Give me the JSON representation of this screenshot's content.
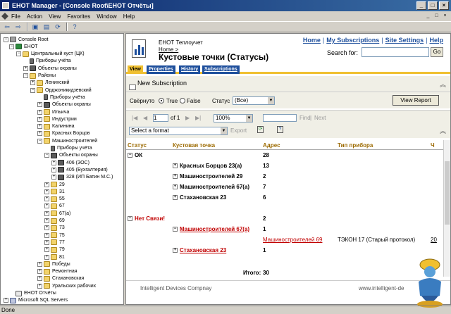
{
  "window": {
    "title": "ЕНОТ Manager - [Console Root\\ЕНОТ Отчёты]",
    "controls": [
      "_",
      "□",
      "×"
    ]
  },
  "menu": {
    "items": [
      "File",
      "Action",
      "View",
      "Favorites",
      "Window",
      "Help"
    ],
    "mdi_controls": [
      "_",
      "□",
      "×"
    ]
  },
  "toolbar": {
    "buttons": [
      "back-icon",
      "forward-icon",
      "up-icon",
      "properties-icon",
      "refresh-icon",
      "help-icon"
    ]
  },
  "tree": {
    "nodes": [
      {
        "label": "Console Root",
        "icon": "root",
        "exp": "-"
      },
      {
        "label": "ЕНОТ",
        "icon": "enot",
        "exp": "-"
      },
      {
        "label": "Центральный куст (ЦК)",
        "icon": "folder",
        "exp": "-"
      },
      {
        "label": "Приборы учёта",
        "icon": "device",
        "exp": ""
      },
      {
        "label": "Объекты охраны",
        "icon": "meter",
        "exp": "+"
      },
      {
        "label": "Районы",
        "icon": "folder",
        "exp": "-"
      },
      {
        "label": "Ленинский",
        "icon": "folder",
        "exp": "+"
      },
      {
        "label": "Орджоникидзевский",
        "icon": "folder",
        "exp": "-"
      },
      {
        "label": "Приборы учёта",
        "icon": "device",
        "exp": ""
      },
      {
        "label": "Объекты охраны",
        "icon": "meter",
        "exp": "+"
      },
      {
        "label": "Ильича",
        "icon": "folder",
        "exp": "+"
      },
      {
        "label": "Индустрии",
        "icon": "folder",
        "exp": "+"
      },
      {
        "label": "Калинина",
        "icon": "folder",
        "exp": "+"
      },
      {
        "label": "Красных Борцов",
        "icon": "folder",
        "exp": "+"
      },
      {
        "label": "Машиностроителей",
        "icon": "folder",
        "exp": "-"
      },
      {
        "label": "Приборы учёта",
        "icon": "device",
        "exp": ""
      },
      {
        "label": "Объекты охраны",
        "icon": "meter",
        "exp": "-"
      },
      {
        "label": "406 (ЗОС)",
        "icon": "meter",
        "exp": "+"
      },
      {
        "label": "405 (Бухгалтерия)",
        "icon": "meter",
        "exp": "+"
      },
      {
        "label": "328 (ИП Батин М.С.)",
        "icon": "meter",
        "exp": "+"
      },
      {
        "label": "29",
        "icon": "folder",
        "exp": "+"
      },
      {
        "label": "31",
        "icon": "folder",
        "exp": "+"
      },
      {
        "label": "55",
        "icon": "folder",
        "exp": "+"
      },
      {
        "label": "67",
        "icon": "folder",
        "exp": "+"
      },
      {
        "label": "67(а)",
        "icon": "folder",
        "exp": "+"
      },
      {
        "label": "69",
        "icon": "folder",
        "exp": "+"
      },
      {
        "label": "73",
        "icon": "folder",
        "exp": "+"
      },
      {
        "label": "75",
        "icon": "folder",
        "exp": "+"
      },
      {
        "label": "77",
        "icon": "folder",
        "exp": "+"
      },
      {
        "label": "79",
        "icon": "folder",
        "exp": "+"
      },
      {
        "label": "81",
        "icon": "folder",
        "exp": "+"
      },
      {
        "label": "Победы",
        "icon": "folder",
        "exp": "+"
      },
      {
        "label": "Ремонтная",
        "icon": "folder",
        "exp": "+"
      },
      {
        "label": "Стахановская",
        "icon": "folder",
        "exp": "+"
      },
      {
        "label": "Уральских рабочих",
        "icon": "folder",
        "exp": "+"
      },
      {
        "label": "ЕНОТ Отчёты",
        "icon": "report",
        "exp": ""
      },
      {
        "label": "Microsoft SQL Servers",
        "icon": "sql",
        "exp": "+"
      }
    ]
  },
  "report": {
    "site_name": "ЕНОТ Теплоучет",
    "breadcrumb": "Home >",
    "heading": "Кустовые точки (Статусы)",
    "top_links": [
      "Home",
      "My Subscriptions",
      "Site Settings",
      "Help"
    ],
    "search_label": "Search for:",
    "search_value": "",
    "go_label": "Go",
    "tabs": [
      "View",
      "Properties",
      "History",
      "Subscriptions"
    ],
    "new_subscription": "New Subscription",
    "params": {
      "flag_label": "Свёрнуто",
      "true_label": "True",
      "false_label": "False",
      "status_label": "Статус",
      "status_value": "(Все)",
      "view_report": "View Report"
    },
    "nav": {
      "first": "|◀",
      "prev": "◀",
      "page": "1",
      "of_label": "of 1",
      "next": "▶",
      "last": "▶|",
      "zoom": "100%",
      "find": "Find",
      "find_sep": "|",
      "next_label": "Next",
      "format_placeholder": "Select a format",
      "export": "Export"
    },
    "columns": [
      "Статус",
      "Кустовая точка",
      "Адрес",
      "Тип прибора",
      "Ч"
    ],
    "rows": [
      {
        "status": "ОК",
        "count": "28"
      },
      {
        "point": "Красных Борцов 23(а)",
        "count": "13"
      },
      {
        "point": "Машиностроителей 29",
        "count": "2"
      },
      {
        "point": "Машиностроителей 67(а)",
        "count": "7"
      },
      {
        "point": "Стахановская 23",
        "count": "6"
      },
      {
        "status": "Нет Связи!",
        "count": "2"
      },
      {
        "point": "Машиностроителей 67(а)",
        "count": "1"
      },
      {
        "address": "Машиностроителей 69",
        "device": "ТЭКОН 17 (Старый протокол)",
        "num": "20"
      },
      {
        "point": "Стахановская 23",
        "count": "1"
      }
    ],
    "total_label": "Итого:",
    "total_value": "30",
    "footer_left": "Intelligent Devices Compnay",
    "footer_right": "www.intelligent-de"
  },
  "status_bar": "Done",
  "colors": {
    "title_bar": "#0a246a",
    "tab_active": "#f0c030",
    "tab": "#1e4f9c",
    "alert": "#c00000"
  }
}
